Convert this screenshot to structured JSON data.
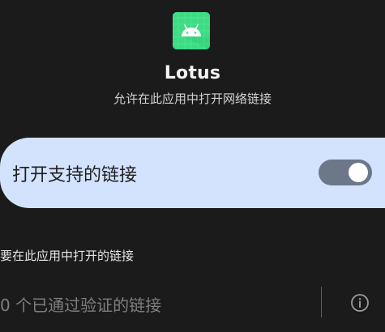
{
  "app": {
    "icon": "android-app-icon",
    "name": "Lotus",
    "subtitle": "允许在此应用中打开网络链接"
  },
  "toggle": {
    "label": "打开支持的链接",
    "checked": true
  },
  "links_section": {
    "header": "要在此应用中打开的链接",
    "verified_text": "0 个已通过验证的链接",
    "info_icon": "info-icon"
  },
  "colors": {
    "background": "#1b1b1b",
    "card": "#d3e3fd",
    "switch_track": "#6c7889",
    "app_icon": "#3ddc84"
  }
}
